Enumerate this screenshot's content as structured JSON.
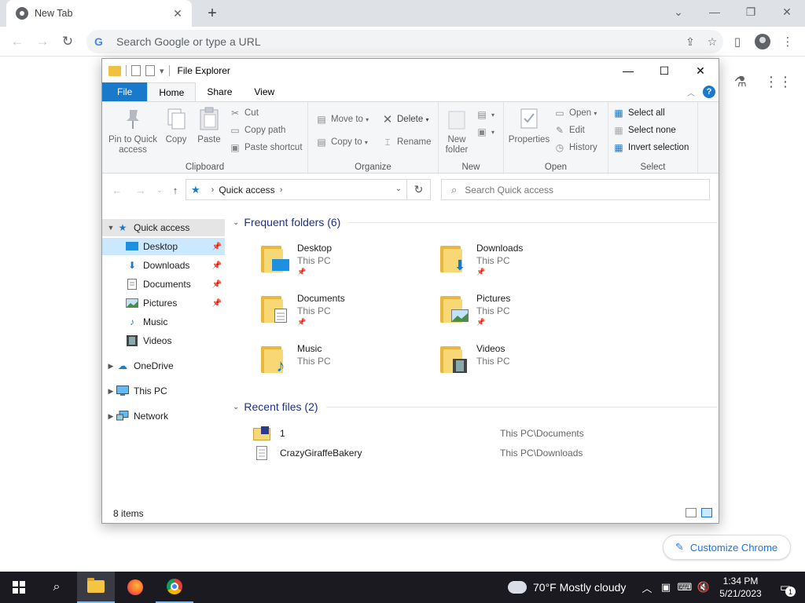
{
  "chrome": {
    "tab_title": "New Tab",
    "tab_close": "✕",
    "new_tab": "+",
    "omnibox_placeholder": "Search Google or type a URL",
    "g_letter": "G",
    "customize_label": "Customize Chrome"
  },
  "explorer": {
    "title": "File Explorer",
    "ribbon_tabs": [
      "File",
      "Home",
      "Share",
      "View"
    ],
    "help": "?",
    "clipboard": {
      "label": "Clipboard",
      "pin": "Pin to Quick access",
      "copy": "Copy",
      "paste": "Paste",
      "cut": "Cut",
      "copy_path": "Copy path",
      "paste_shortcut": "Paste shortcut"
    },
    "organize": {
      "label": "Organize",
      "move_to": "Move to",
      "copy_to": "Copy to",
      "delete": "Delete",
      "rename": "Rename"
    },
    "new": {
      "label": "New",
      "new_folder": "New folder"
    },
    "open": {
      "label": "Open",
      "properties": "Properties",
      "open": "Open",
      "edit": "Edit",
      "history": "History"
    },
    "select": {
      "label": "Select",
      "select_all": "Select all",
      "select_none": "Select none",
      "invert": "Invert selection"
    },
    "address": {
      "crumb": "Quick access",
      "search_placeholder": "Search Quick access"
    },
    "nav": {
      "quick_access": "Quick access",
      "desktop": "Desktop",
      "downloads": "Downloads",
      "documents": "Documents",
      "pictures": "Pictures",
      "music": "Music",
      "videos": "Videos",
      "onedrive": "OneDrive",
      "this_pc": "This PC",
      "network": "Network"
    },
    "frequent_header": "Frequent folders (6)",
    "folders": [
      {
        "name": "Desktop",
        "location": "This PC"
      },
      {
        "name": "Downloads",
        "location": "This PC"
      },
      {
        "name": "Documents",
        "location": "This PC"
      },
      {
        "name": "Pictures",
        "location": "This PC"
      },
      {
        "name": "Music",
        "location": "This PC"
      },
      {
        "name": "Videos",
        "location": "This PC"
      }
    ],
    "recent_header": "Recent files (2)",
    "recent": [
      {
        "name": "1",
        "path": "This PC\\Documents"
      },
      {
        "name": "CrazyGiraffeBakery",
        "path": "This PC\\Downloads"
      }
    ],
    "status": "8 items"
  },
  "taskbar": {
    "weather": "70°F  Mostly cloudy",
    "time": "1:34 PM",
    "date": "5/21/2023",
    "notif_count": "1"
  }
}
